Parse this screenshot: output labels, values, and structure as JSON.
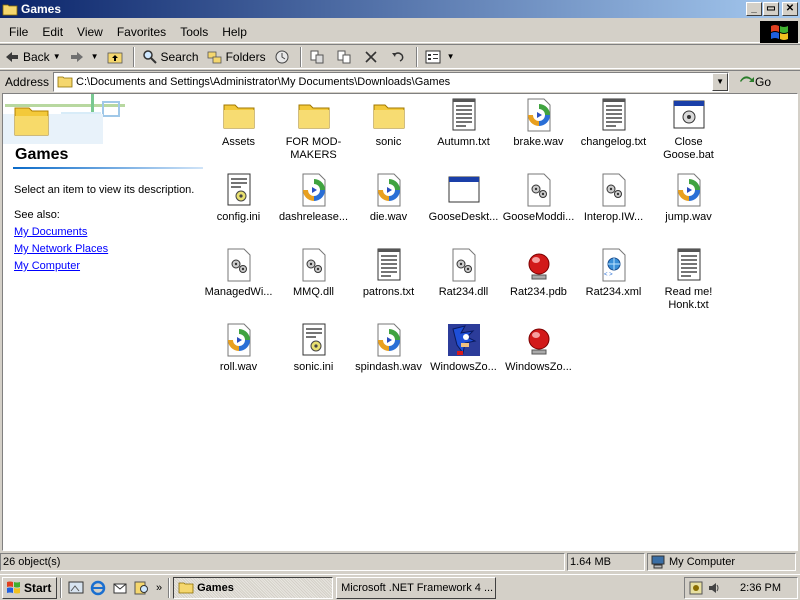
{
  "window": {
    "title": "Games",
    "buttons": {
      "minimize": "_",
      "maximize": "▭",
      "close": "✕"
    }
  },
  "menu": [
    "File",
    "Edit",
    "View",
    "Favorites",
    "Tools",
    "Help"
  ],
  "toolbar": {
    "back_label": "Back",
    "search_label": "Search",
    "folders_label": "Folders"
  },
  "address": {
    "label": "Address",
    "path": "C:\\Documents and Settings\\Administrator\\My Documents\\Downloads\\Games",
    "go_label": "Go"
  },
  "left_pane": {
    "title": "Games",
    "description": "Select an item to view its description.",
    "see_also": "See also:",
    "links": [
      "My Documents",
      "My Network Places",
      "My Computer"
    ]
  },
  "items": [
    {
      "label": "Assets",
      "icon": "folder-icon"
    },
    {
      "label": "FOR MOD-MAKERS",
      "icon": "folder-icon"
    },
    {
      "label": "sonic",
      "icon": "folder-icon"
    },
    {
      "label": "Autumn.txt",
      "icon": "text-file-icon"
    },
    {
      "label": "brake.wav",
      "icon": "audio-file-icon"
    },
    {
      "label": "changelog.txt",
      "icon": "text-file-icon"
    },
    {
      "label": "Close Goose.bat",
      "icon": "batch-file-icon"
    },
    {
      "label": "config.ini",
      "icon": "ini-file-icon"
    },
    {
      "label": "dashrelease...",
      "icon": "audio-file-icon"
    },
    {
      "label": "die.wav",
      "icon": "audio-file-icon"
    },
    {
      "label": "GooseDeskt...",
      "icon": "application-icon"
    },
    {
      "label": "GooseModdi...",
      "icon": "dll-file-icon"
    },
    {
      "label": "Interop.IW...",
      "icon": "dll-file-icon"
    },
    {
      "label": "jump.wav",
      "icon": "audio-file-icon"
    },
    {
      "label": "ManagedWi...",
      "icon": "dll-file-icon"
    },
    {
      "label": "MMQ.dll",
      "icon": "dll-file-icon"
    },
    {
      "label": "patrons.txt",
      "icon": "text-file-icon"
    },
    {
      "label": "Rat234.dll",
      "icon": "dll-file-icon"
    },
    {
      "label": "Rat234.pdb",
      "icon": "pdb-file-icon"
    },
    {
      "label": "Rat234.xml",
      "icon": "xml-file-icon"
    },
    {
      "label": "Read me! Honk.txt",
      "icon": "text-file-icon"
    },
    {
      "label": "roll.wav",
      "icon": "audio-file-icon"
    },
    {
      "label": "sonic.ini",
      "icon": "ini-file-icon"
    },
    {
      "label": "spindash.wav",
      "icon": "audio-file-icon"
    },
    {
      "label": "WindowsZo...",
      "icon": "sonic-app-icon"
    },
    {
      "label": "WindowsZo...",
      "icon": "pdb-file-icon"
    }
  ],
  "status": {
    "objects": "26 object(s)",
    "size": "1.64 MB",
    "zone": "My Computer"
  },
  "taskbar": {
    "start_label": "Start",
    "tasks": [
      "Games",
      "Microsoft .NET Framework 4 ..."
    ],
    "clock": "2:36 PM"
  },
  "colors": {
    "title_gradient_start": "#0a246a",
    "title_gradient_end": "#a6caf0",
    "link": "#0000ff",
    "face": "#d4d0c8"
  }
}
